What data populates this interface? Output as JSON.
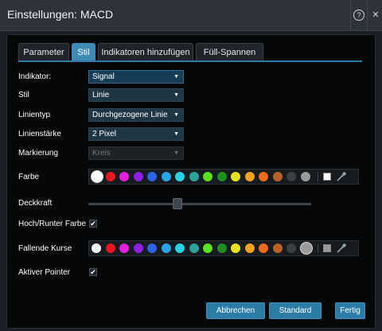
{
  "window": {
    "title": "Einstellungen: MACD",
    "help_icon": "?",
    "close_icon": "✕"
  },
  "tabs": [
    {
      "label": "Parameter"
    },
    {
      "label": "Stil"
    },
    {
      "label": "Indikatoren hinzufügen"
    },
    {
      "label": "Füll-Spannen"
    }
  ],
  "active_tab": "Stil",
  "form": {
    "indikator": {
      "label": "Indikator:",
      "value": "Signal"
    },
    "stil": {
      "label": "Stil",
      "value": "Linie"
    },
    "linientyp": {
      "label": "Linientyp",
      "value": "Durchgezogene Linie"
    },
    "linienstaerke": {
      "label": "Linienstärke",
      "value": "2 Pixel"
    },
    "markierung": {
      "label": "Markierung",
      "value": "Kreis",
      "disabled": true
    },
    "farbe": {
      "label": "Farbe",
      "current_color": "#ffffff"
    },
    "deckkraft": {
      "label": "Deckkraft",
      "value": 0.4
    },
    "hoch_runter_farbe": {
      "label": "Hoch/Runter Farbe",
      "checked": true
    },
    "fallende_kurse": {
      "label": "Fallende Kurse",
      "current_color": "#9a9a9a"
    },
    "aktiver_pointer": {
      "label": "Aktiver Pointer",
      "checked": true
    }
  },
  "caret_glyph": "▼",
  "check_glyph": "✔",
  "palette": [
    "#ffffff",
    "#e8161d",
    "#e61ee0",
    "#8e1ee0",
    "#2b64e8",
    "#2aa3e8",
    "#28d2e2",
    "#2aa39b",
    "#59e21e",
    "#1f8f1f",
    "#e8e41a",
    "#f4a21f",
    "#f06a1a",
    "#b8622a",
    "#3a3f44",
    "#9a9a9a"
  ],
  "buttons": {
    "abbrechen": "Abbrechen",
    "standard": "Standard",
    "fertig": "Fertig"
  }
}
